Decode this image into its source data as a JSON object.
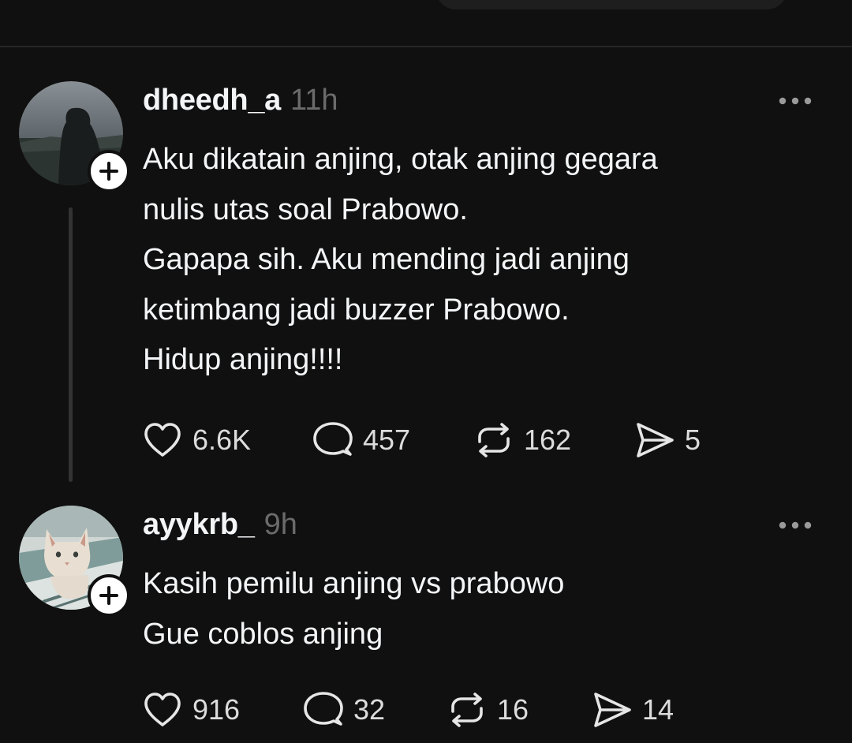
{
  "posts": [
    {
      "username": "dheedh_a",
      "time": "11h",
      "text": "Aku dikatain anjing, otak anjing gegara\nnulis utas soal Prabowo.\nGapapa sih. Aku mending jadi anjing\nketimbang jadi buzzer Prabowo.\nHidup anjing!!!!",
      "likes": "6.6K",
      "replies": "457",
      "reposts": "162",
      "shares": "5",
      "avatar_icon": "person-silhouette-avatar"
    },
    {
      "username": "ayykrb_",
      "time": "9h",
      "text": "Kasih pemilu anjing vs prabowo\nGue coblos anjing",
      "likes": "916",
      "replies": "32",
      "reposts": "16",
      "shares": "14",
      "avatar_icon": "cat-avatar"
    }
  ],
  "icons": {
    "like": "heart-icon",
    "reply": "comment-icon",
    "repost": "repost-icon",
    "share": "send-icon",
    "more": "more-dots-icon",
    "follow": "plus-icon"
  },
  "colors": {
    "background": "#101010",
    "text": "#f3f5f7",
    "muted": "#6b6b6b",
    "divider": "#262626",
    "thread_line": "#333333"
  }
}
